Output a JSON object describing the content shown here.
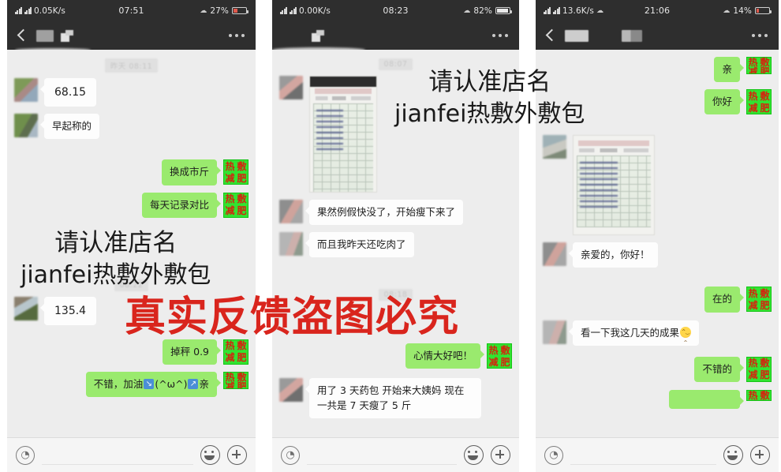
{
  "watermarks": {
    "shop_line1": "请认准店名",
    "shop_line2": "jianfei热敷外敷包",
    "warning": "真实反馈盗图必究",
    "black_color": "#1a1a1a",
    "red_color": "#d9251d"
  },
  "badge": {
    "chars": [
      "热",
      "敷",
      "减",
      "肥"
    ],
    "bg_color": "#31e431",
    "text_color": "#d6220e"
  },
  "panels": [
    {
      "id": "panel-1",
      "status": {
        "network_speed": "0.05K/s",
        "time": "07:51",
        "battery_percent": "27%",
        "battery_level": 27,
        "battery_low": true
      },
      "nav": {
        "back_icon": "back-chevron-icon",
        "more_icon": "more-options-icon"
      },
      "timestamps": [
        "昨天 08:11",
        "08:22"
      ],
      "messages": [
        {
          "side": "in",
          "type": "text",
          "text": "68.15",
          "avatar": "av-a",
          "numeric": true
        },
        {
          "side": "in",
          "type": "text",
          "text": "早起称的",
          "avatar": "av-b"
        },
        {
          "side": "out",
          "type": "text",
          "text": "换成市斤"
        },
        {
          "side": "out",
          "type": "text",
          "text": "每天记录对比"
        },
        {
          "side": "in",
          "type": "text",
          "text": "135.4",
          "avatar": "av-c",
          "numeric": true
        },
        {
          "side": "out",
          "type": "text",
          "text": "掉秤 0.9"
        },
        {
          "side": "out",
          "type": "emoji-text",
          "prefix": "不错，加油",
          "middle": "(^ω^)",
          "suffix": "亲"
        }
      ]
    },
    {
      "id": "panel-2",
      "status": {
        "network_speed": "0.00K/s",
        "time": "08:23",
        "battery_percent": "82%",
        "battery_level": 82,
        "battery_low": false
      },
      "nav": {
        "back_icon": "back-chevron-icon",
        "more_icon": "more-options-icon"
      },
      "timestamps": [
        "08:07",
        "08:18"
      ],
      "messages": [
        {
          "side": "in",
          "type": "photo",
          "alt": "手写记录表照片",
          "avatar": "av-d"
        },
        {
          "side": "in",
          "type": "text",
          "text": "果然例假快没了，开始瘦下来了",
          "avatar": "av-e"
        },
        {
          "side": "in",
          "type": "text",
          "text": "而且我昨天还吃肉了",
          "avatar": "av-f"
        },
        {
          "side": "out",
          "type": "text",
          "text": "心情大好吧！"
        },
        {
          "side": "in",
          "type": "text",
          "text": "用了 3 天药包 开始来大姨妈 现在一共是 7 天瘦了 5 斤",
          "avatar": "av-d"
        }
      ]
    },
    {
      "id": "panel-3",
      "status": {
        "network_speed": "13.6K/s",
        "time": "21:06",
        "battery_percent": "14%",
        "battery_level": 14,
        "battery_low": true
      },
      "nav": {
        "back_icon": "back-chevron-icon",
        "more_icon": "more-options-icon"
      },
      "timestamps": [],
      "messages": [
        {
          "side": "out",
          "type": "text",
          "text": "亲"
        },
        {
          "side": "out",
          "type": "text",
          "text": "你好"
        },
        {
          "side": "in",
          "type": "photo",
          "alt": "手写记录表照片",
          "avatar": "av-g"
        },
        {
          "side": "in",
          "type": "text",
          "text": "亲爱的，你好！",
          "avatar": "av-e"
        },
        {
          "side": "out",
          "type": "text",
          "text": "在的"
        },
        {
          "side": "in",
          "type": "emoji-end",
          "text": "看一下我这几天的成果",
          "avatar": "av-f"
        },
        {
          "side": "out",
          "type": "text",
          "text": "不错的"
        },
        {
          "side": "out",
          "type": "partial",
          "text": ""
        }
      ]
    }
  ],
  "inputbar": {
    "voice_icon": "voice-record-icon",
    "emoji_icon": "emoji-picker-icon",
    "plus_icon": "add-attachment-icon",
    "placeholder": ""
  }
}
